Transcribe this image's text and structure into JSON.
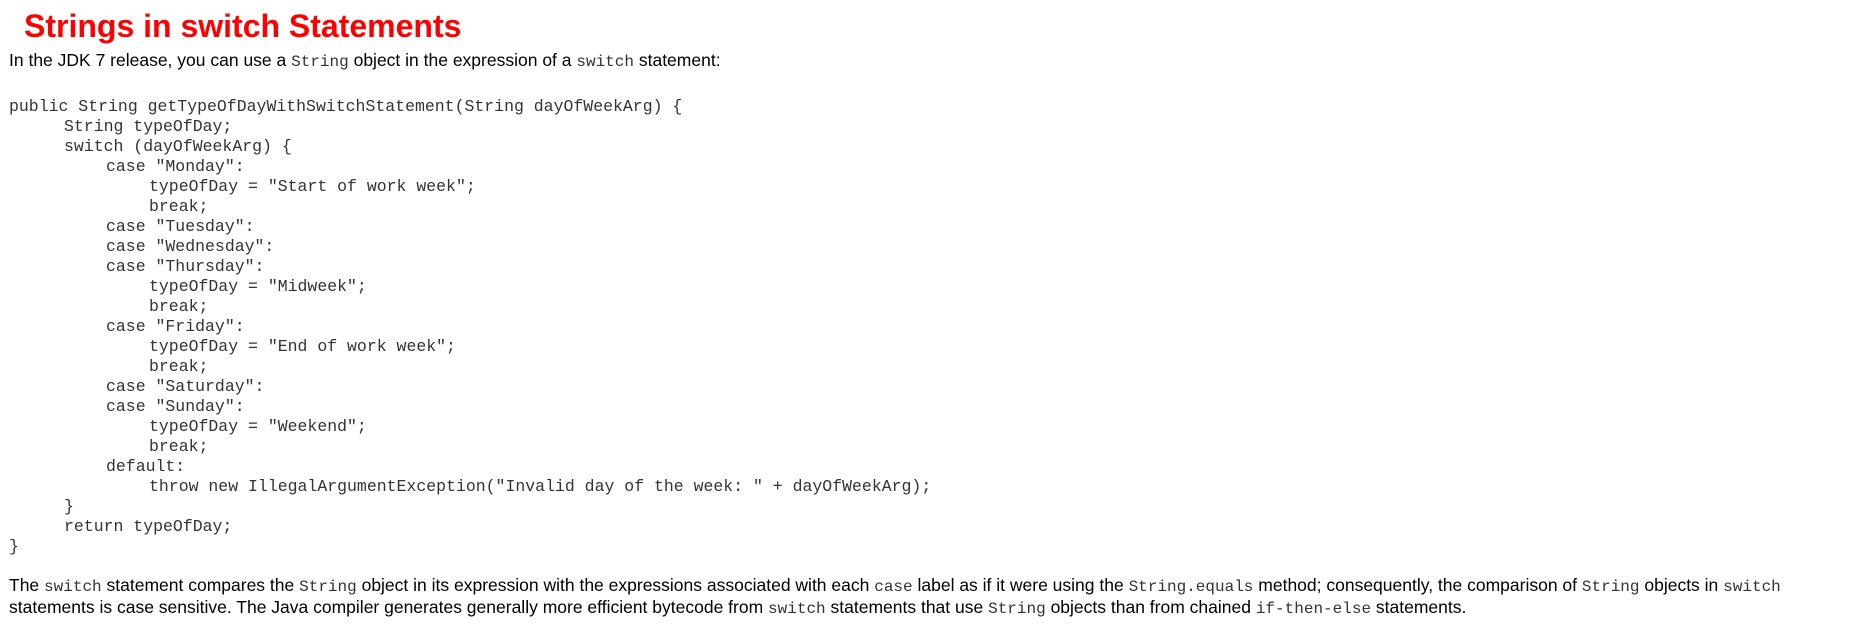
{
  "heading": "Strings in switch Statements",
  "intro": {
    "t1": "In the JDK 7 release, you can use a ",
    "c1": "String",
    "t2": " object in the expression of a ",
    "c2": "switch",
    "t3": " statement:"
  },
  "code_lines": [
    "public String getTypeOfDayWithSwitchStatement(String dayOfWeekArg) {",
    "String typeOfDay;",
    "switch (dayOfWeekArg) {",
    "case \"Monday\":",
    "typeOfDay = \"Start of work week\";",
    "break;",
    "case \"Tuesday\":",
    "case \"Wednesday\":",
    "case \"Thursday\":",
    "typeOfDay = \"Midweek\";",
    "break;",
    "case \"Friday\":",
    "typeOfDay = \"End of work week\";",
    "break;",
    "case \"Saturday\":",
    "case \"Sunday\":",
    "typeOfDay = \"Weekend\";",
    "break;",
    "default:",
    "throw new IllegalArgumentException(\"Invalid day of the week: \" + dayOfWeekArg);",
    "}",
    "return typeOfDay;",
    "}"
  ],
  "explanation": {
    "line1": {
      "t1": "The ",
      "c1": "switch",
      "t2": " statement compares the ",
      "c2": "String",
      "t3": " object in its expression with the expressions associated with each ",
      "c3": "case",
      "t4": " label as if it were using the ",
      "c4": "String.equals",
      "t5": " method; consequently, the comparison of ",
      "c5": "String",
      "t6": " objects in ",
      "c6": "switch"
    },
    "line2": {
      "t1": "statements is case sensitive. The Java compiler generates generally more efficient bytecode from ",
      "c1": "switch",
      "t2": " statements that use ",
      "c2": "String",
      "t3": " objects than from chained ",
      "c3": "if-then-else",
      "t4": " statements."
    }
  },
  "colors": {
    "heading": "#ff0000",
    "code_text": "#333333",
    "body_text": "#000000"
  }
}
